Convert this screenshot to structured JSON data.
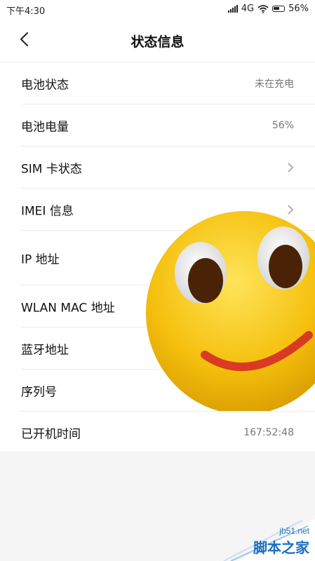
{
  "status_bar": {
    "time": "下午4:30",
    "network": "4G",
    "battery": "56%"
  },
  "header": {
    "title": "状态信息",
    "back_icon": "chevron-left-icon"
  },
  "items": [
    {
      "label": "电池状态",
      "value": "未在充电"
    },
    {
      "label": "电池电量",
      "value": "56%"
    },
    {
      "label": "SIM 卡状态",
      "value": ""
    },
    {
      "label": "IMEI 信息",
      "value": ""
    },
    {
      "label": "IP 地址",
      "value": ""
    },
    {
      "label": "WLAN MAC 地址",
      "value": ""
    },
    {
      "label": "蓝牙地址",
      "value": ""
    },
    {
      "label": "序列号",
      "value": ""
    },
    {
      "label": "已开机时间",
      "value": "167:52:48"
    }
  ],
  "watermark": {
    "url": "jb51.net",
    "name": "脚本之家"
  },
  "colors": {
    "smiley": "#f5c00e",
    "mouth": "#d93a22",
    "watermark": "#1a6fc0"
  }
}
